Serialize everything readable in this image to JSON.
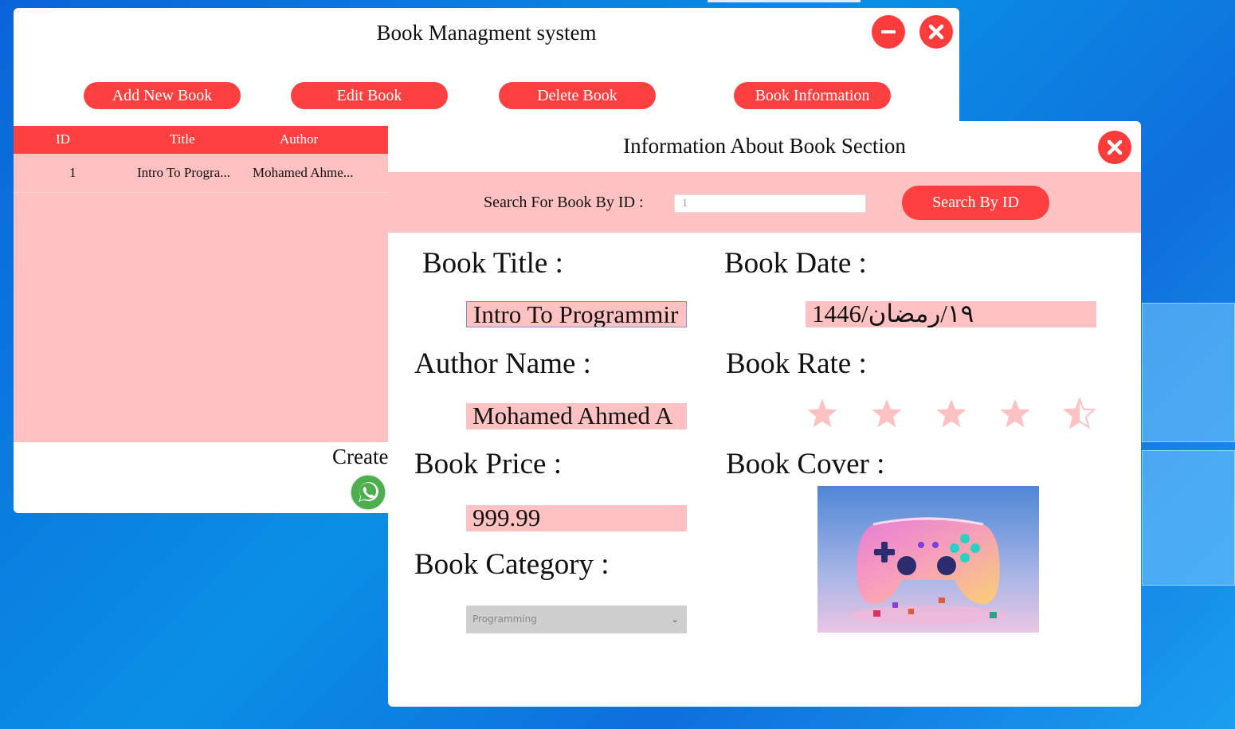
{
  "main_window": {
    "title": "Book Managment system",
    "minimize_icon": "minimize-icon",
    "close_icon": "close-icon",
    "toolbar": {
      "add_label": "Add New Book",
      "edit_label": "Edit Book",
      "delete_label": "Delete Book",
      "info_label": "Book Information"
    },
    "table": {
      "columns": [
        "ID",
        "Title",
        "Author"
      ],
      "rows": [
        {
          "id": "1",
          "title": "Intro To Progra...",
          "author": "Mohamed Ahme..."
        }
      ]
    },
    "footer_text": "Create",
    "contact_icon": "whatsapp-icon"
  },
  "info_dialog": {
    "title": "Information About Book Section",
    "close_icon": "close-icon",
    "search": {
      "label": "Search For Book By ID :",
      "value": "1",
      "button_label": "Search By ID"
    },
    "labels": {
      "title": "Book Title :",
      "date": "Book Date :",
      "author": "Author Name :",
      "rate": "Book Rate :",
      "price": "Book Price :",
      "cover": "Book Cover :",
      "category": "Book Category :"
    },
    "values": {
      "title": "Intro To Programmir",
      "date": "1446/١٩/رمضان",
      "author": "Mohamed Ahmed A",
      "price": "999.99",
      "category": "Programming",
      "rating": 4.5,
      "rating_max": 5
    },
    "cover_image": "game-controller-image"
  },
  "colors": {
    "accent": "#ff4040",
    "panel_pink": "#ffc1c1",
    "star": "#ffc1c1",
    "desktop_blue": "#0a8fe6"
  }
}
